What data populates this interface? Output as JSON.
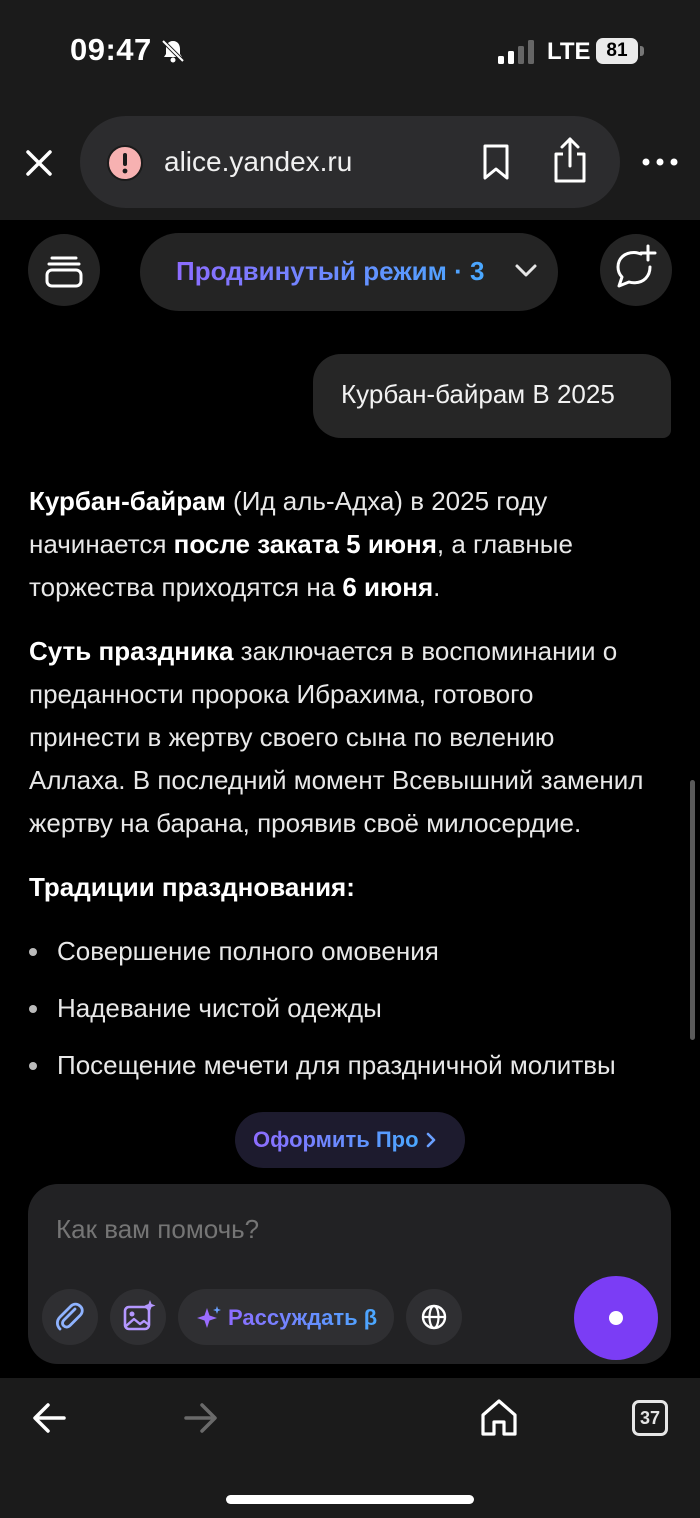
{
  "status_bar": {
    "time": "09:47",
    "network": "LTE",
    "battery": "81",
    "icons": [
      "bell-slash-icon",
      "signal-icon"
    ]
  },
  "browser": {
    "url": "alice.yandex.ru",
    "icons": [
      "close-icon",
      "warning-icon",
      "bookmark-icon",
      "share-icon",
      "more-icon"
    ]
  },
  "header": {
    "mode_label": "Продвинутый режим · 3",
    "icons": [
      "history-icon",
      "new-chat-icon",
      "chevron-down-icon"
    ]
  },
  "chat": {
    "user_message": "Курбан-байрам В 2025",
    "answer": {
      "p1": {
        "b1": "Курбан-байрам",
        "t1": " (Ид аль-Адха) в 2025 году начинается ",
        "b2": "после заката 5 июня",
        "t2": ", а главные торжества приходятся на ",
        "b3": "6 июня",
        "t3": "."
      },
      "p2": {
        "b1": "Суть праздника",
        "t1": " заключается в воспоминании о преданности пророка Ибрахима, готового принести в жертву своего сына по велению Аллаха. В последний момент Всевышний заменил жертву на барана, проявив своё милосердие."
      },
      "traditions_heading": "Традиции празднования:",
      "traditions": [
        "Совершение полного омовения",
        "Надевание чистой одежды",
        "Посещение мечети для праздничной молитвы"
      ]
    }
  },
  "pro_button": {
    "label": "Оформить Про"
  },
  "composer": {
    "placeholder": "Как вам помочь?",
    "think_label": "Рассуждать β",
    "icons": [
      "paperclip-icon",
      "image-sparkle-icon",
      "sparkle-icon",
      "globe-icon",
      "voice-icon"
    ]
  },
  "bottom_bar": {
    "tabs_count": "37",
    "icons": [
      "back-arrow-icon",
      "forward-arrow-icon",
      "home-icon"
    ]
  },
  "colors": {
    "accent_gradient_start": "#8d6cff",
    "accent_gradient_end": "#4aa8ff",
    "voice_button": "#7b3df5",
    "background": "#000000"
  }
}
